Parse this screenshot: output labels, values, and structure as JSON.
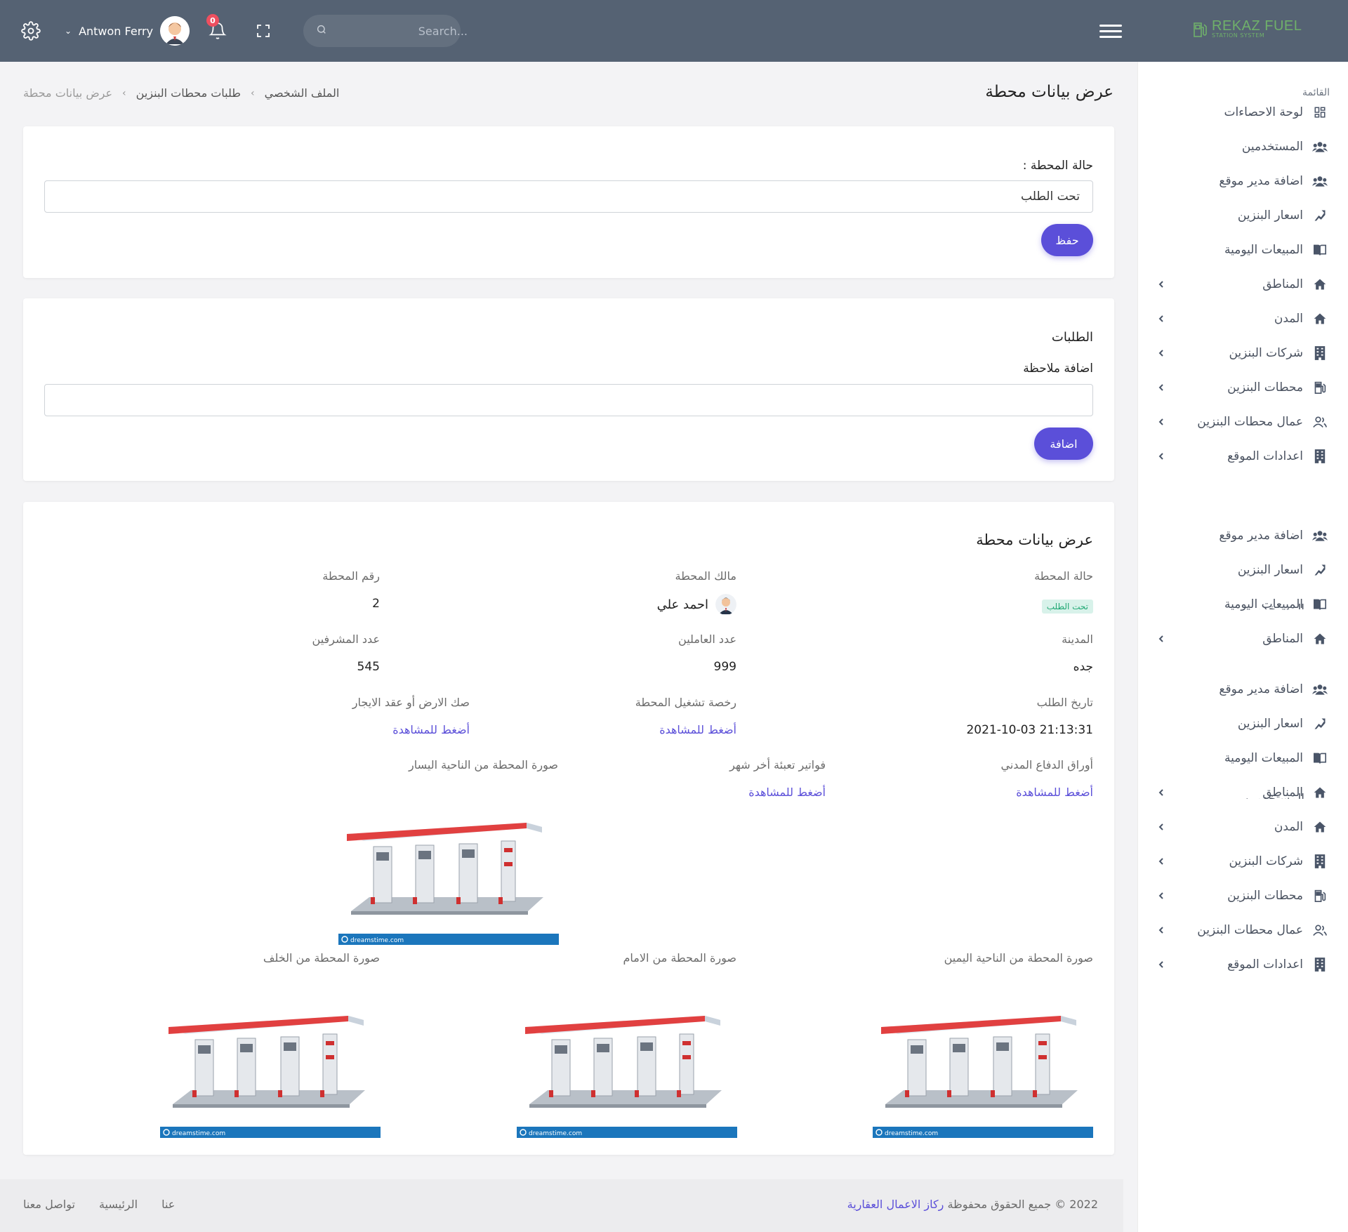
{
  "topbar": {
    "user_name": "Antwon Ferry",
    "notification_count": "0",
    "search_placeholder": "Search...",
    "logo_main": "REKAZ FUEL",
    "logo_sub": "STATION SYSTEM"
  },
  "page": {
    "title": "عرض بيانات محطة",
    "breadcrumb": [
      "الملف الشخصي",
      "طلبات محطات البنزين",
      "عرض بيانات محطة"
    ]
  },
  "status_card": {
    "label": "حالة المحطة :",
    "value": "تحت الطلب",
    "save_label": "حفظ"
  },
  "requests_card": {
    "title": "الطلبات",
    "note_label": "اضافة ملاحظة",
    "note_value": "",
    "add_label": "اضافة"
  },
  "details": {
    "title": "عرض بيانات محطة",
    "status_label": "حالة المحطة",
    "status_value": "تحت الطلب",
    "owner_label": "مالك المحطة",
    "owner_value": "احمد علي",
    "number_label": "رقم المحطة",
    "number_value": "2",
    "city_label": "المدينة",
    "city_value": "جده",
    "workers_label": "عدد العاملين",
    "workers_value": "999",
    "supervisors_label": "عدد المشرفين",
    "supervisors_value": "545",
    "date_label": "تاريخ الطلب",
    "date_value": "2021-10-03 21:13:31",
    "license_label": "رخصة تشغيل المحطة",
    "license_link": "أضغط للمشاهدة",
    "deed_label": "صك الارض أو عقد الايجار",
    "deed_link": "أضغط للمشاهدة",
    "civil_label": "أوراق الدفاع المدني",
    "civil_link": "أضغط للمشاهدة",
    "bills_label": "فواتير تعبئة أخر شهر",
    "bills_link": "أضغط للمشاهدة",
    "left_photo_label": "صورة المحطة من الناحية اليسار",
    "right_photo_label": "صورة المحطة من الناحية اليمين",
    "front_photo_label": "صورة المحطة من الامام",
    "back_photo_label": "صورة المحطة من الخلف",
    "watermark": "dreamstime.com"
  },
  "sidebar": {
    "title": "القائمة",
    "items": [
      {
        "label": "لوحة الاحصاءات",
        "icon": "dashboard-icon",
        "chev": false
      },
      {
        "label": "المستخدمين",
        "icon": "users-icon",
        "chev": false
      },
      {
        "label": "اضافة مدير موقع",
        "icon": "users-icon",
        "chev": false
      },
      {
        "label": "اسعار البنزين",
        "icon": "chart-icon",
        "chev": false
      },
      {
        "label": "المبيعات اليومية",
        "icon": "book-icon",
        "chev": false
      },
      {
        "label": "المناطق",
        "icon": "home-icon",
        "chev": true
      },
      {
        "label": "المدن",
        "icon": "home-icon",
        "chev": true
      },
      {
        "label": "شركات البنزين",
        "icon": "building-icon",
        "chev": true
      },
      {
        "label": "محطات البنزين",
        "icon": "fuel-icon",
        "chev": true
      },
      {
        "label": "عمال محطات البنزين",
        "icon": "user-group-icon",
        "chev": true
      },
      {
        "label": "اعدادات الموقع",
        "icon": "building-icon",
        "chev": true
      },
      {
        "label": "اضافة مدير موقع",
        "icon": "users-icon",
        "chev": false
      },
      {
        "label": "اسعار البنزين",
        "icon": "chart-icon",
        "chev": false
      },
      {
        "label": "المبيعات اليومية",
        "icon": "book-icon",
        "chev": false
      },
      {
        "label": "المناطق",
        "icon": "home-icon",
        "chev": true
      },
      {
        "label": "اضافة مدير موقع",
        "icon": "users-icon",
        "chev": false
      },
      {
        "label": "اسعار البنزين",
        "icon": "chart-icon",
        "chev": false
      },
      {
        "label": "المبيعات اليومية",
        "icon": "book-icon",
        "chev": false
      },
      {
        "label": "المناطق",
        "icon": "home-icon",
        "chev": true
      },
      {
        "label": "المدن",
        "icon": "home-icon",
        "chev": true
      },
      {
        "label": "شركات البنزين",
        "icon": "building-icon",
        "chev": true
      },
      {
        "label": "محطات البنزين",
        "icon": "fuel-icon",
        "chev": true
      },
      {
        "label": "عمال محطات البنزين",
        "icon": "user-group-icon",
        "chev": true
      },
      {
        "label": "اعدادات الموقع",
        "icon": "building-icon",
        "chev": true
      }
    ],
    "ghost_label": "المستخدمين"
  },
  "footer": {
    "copyright": "2022 © جميع الحقوق محفوظة",
    "brand": "ركاز الاعمال العقارية",
    "links": [
      "عنا",
      "الرئيسية",
      "تواصل معنا"
    ]
  }
}
